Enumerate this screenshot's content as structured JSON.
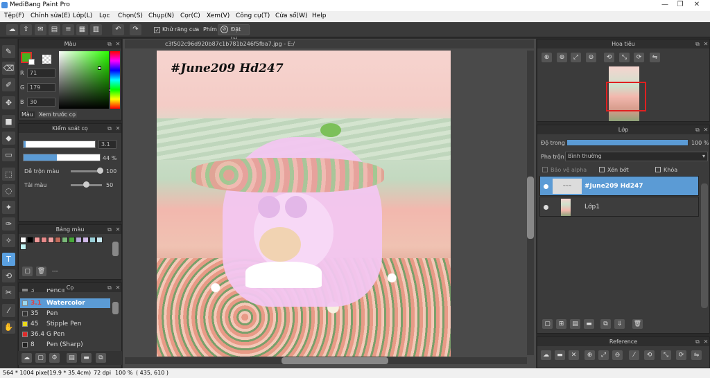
{
  "app": {
    "title": "MediBang Paint Pro"
  },
  "window": {
    "minimize": "—",
    "restore": "❐",
    "close": "✕"
  },
  "menu": [
    "Tệp(F)",
    "Chỉnh sửa(E)",
    "Lớp(L)",
    "Lọc",
    "Chọn(S)",
    "Chụp(N)",
    "Cọr(C)",
    "Xem(V)",
    "Công cụ(T)",
    "Cửa sổ(W)",
    "Help"
  ],
  "toolbar": {
    "antialias_label": "Khử răng cưa",
    "key_label": "Phím",
    "reset_label": "Đặt lại"
  },
  "color_panel": {
    "title": "Màu",
    "r_label": "R",
    "g_label": "G",
    "b_label": "B",
    "r": "71",
    "g": "179",
    "b": "30",
    "tab_color": "Màu",
    "tab_preview": "Xem trước cọ",
    "fg": "#47b31e"
  },
  "brush_control": {
    "title": "Kiểm soát cọ",
    "size": "3.1",
    "opacity": "44 %",
    "blend_label": "Dễ trộn màu",
    "blend_value": "100",
    "load_label": "Tải màu",
    "load_value": "50"
  },
  "palette": {
    "title": "Bảng màu",
    "dash": "---",
    "swatches": [
      "#ffffff",
      "#000000",
      "#f29a9a",
      "#e88a8a",
      "#f0a0a0",
      "#c06a5a",
      "#7bb97a",
      "#48a83a",
      "#b6a6d8",
      "#d0b8e8",
      "#9ad0d8",
      "#c8e8f0"
    ]
  },
  "brush_panel": {
    "title": "Cọ",
    "items": [
      {
        "size": "3",
        "name": "Pencil",
        "color": "#888888"
      },
      {
        "size": "3.1",
        "name": "Watercolor",
        "color": "#9ad8f0"
      },
      {
        "size": "35",
        "name": "Pen",
        "color": "#333333"
      },
      {
        "size": "45",
        "name": "Stipple Pen",
        "color": "#e8d81a"
      },
      {
        "size": "36.4",
        "name": "G Pen",
        "color": "#e02a2a"
      },
      {
        "size": "8",
        "name": "Pen (Sharp)",
        "color": "#222222"
      }
    ]
  },
  "document": {
    "tab": "c3f502c96d920b87c1b781b246f5fba7.jpg - E:/",
    "artwork_text": "#June209 Hd247"
  },
  "navigator": {
    "title": "Hoa tiêu"
  },
  "layer_panel": {
    "title": "Lớp",
    "opacity_label": "Độ trong",
    "opacity_value": "100 %",
    "blend_label": "Pha trộn",
    "blend_value": "Bình thường",
    "protect_alpha": "Bảo vệ alpha",
    "clip": "Xén bớt",
    "lock": "Khóa",
    "layers": [
      {
        "name": "#June209 Hd247",
        "selected": true
      },
      {
        "name": "Lớp1",
        "selected": false
      }
    ]
  },
  "reference": {
    "title": "Reference"
  },
  "status": {
    "size": "564 * 1004 pixel",
    "cm": "(19.9 * 35.4cm)",
    "dpi": "72 dpi",
    "zoom": "100 %",
    "coords": "( 435, 610 )"
  }
}
